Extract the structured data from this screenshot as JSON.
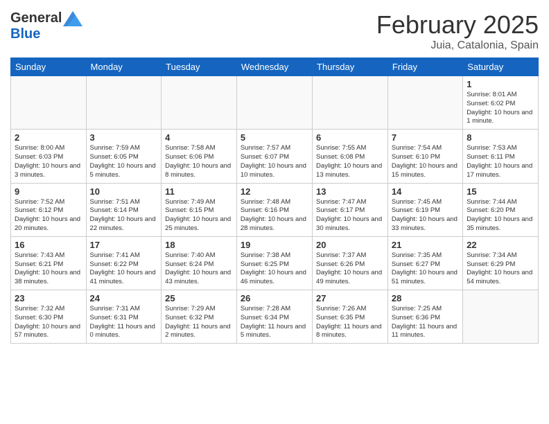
{
  "header": {
    "logo_general": "General",
    "logo_blue": "Blue",
    "title": "February 2025",
    "location": "Juia, Catalonia, Spain"
  },
  "days_of_week": [
    "Sunday",
    "Monday",
    "Tuesday",
    "Wednesday",
    "Thursday",
    "Friday",
    "Saturday"
  ],
  "weeks": [
    [
      {
        "day": "",
        "info": ""
      },
      {
        "day": "",
        "info": ""
      },
      {
        "day": "",
        "info": ""
      },
      {
        "day": "",
        "info": ""
      },
      {
        "day": "",
        "info": ""
      },
      {
        "day": "",
        "info": ""
      },
      {
        "day": "1",
        "info": "Sunrise: 8:01 AM\nSunset: 6:02 PM\nDaylight: 10 hours and 1 minute."
      }
    ],
    [
      {
        "day": "2",
        "info": "Sunrise: 8:00 AM\nSunset: 6:03 PM\nDaylight: 10 hours and 3 minutes."
      },
      {
        "day": "3",
        "info": "Sunrise: 7:59 AM\nSunset: 6:05 PM\nDaylight: 10 hours and 5 minutes."
      },
      {
        "day": "4",
        "info": "Sunrise: 7:58 AM\nSunset: 6:06 PM\nDaylight: 10 hours and 8 minutes."
      },
      {
        "day": "5",
        "info": "Sunrise: 7:57 AM\nSunset: 6:07 PM\nDaylight: 10 hours and 10 minutes."
      },
      {
        "day": "6",
        "info": "Sunrise: 7:55 AM\nSunset: 6:08 PM\nDaylight: 10 hours and 13 minutes."
      },
      {
        "day": "7",
        "info": "Sunrise: 7:54 AM\nSunset: 6:10 PM\nDaylight: 10 hours and 15 minutes."
      },
      {
        "day": "8",
        "info": "Sunrise: 7:53 AM\nSunset: 6:11 PM\nDaylight: 10 hours and 17 minutes."
      }
    ],
    [
      {
        "day": "9",
        "info": "Sunrise: 7:52 AM\nSunset: 6:12 PM\nDaylight: 10 hours and 20 minutes."
      },
      {
        "day": "10",
        "info": "Sunrise: 7:51 AM\nSunset: 6:14 PM\nDaylight: 10 hours and 22 minutes."
      },
      {
        "day": "11",
        "info": "Sunrise: 7:49 AM\nSunset: 6:15 PM\nDaylight: 10 hours and 25 minutes."
      },
      {
        "day": "12",
        "info": "Sunrise: 7:48 AM\nSunset: 6:16 PM\nDaylight: 10 hours and 28 minutes."
      },
      {
        "day": "13",
        "info": "Sunrise: 7:47 AM\nSunset: 6:17 PM\nDaylight: 10 hours and 30 minutes."
      },
      {
        "day": "14",
        "info": "Sunrise: 7:45 AM\nSunset: 6:19 PM\nDaylight: 10 hours and 33 minutes."
      },
      {
        "day": "15",
        "info": "Sunrise: 7:44 AM\nSunset: 6:20 PM\nDaylight: 10 hours and 35 minutes."
      }
    ],
    [
      {
        "day": "16",
        "info": "Sunrise: 7:43 AM\nSunset: 6:21 PM\nDaylight: 10 hours and 38 minutes."
      },
      {
        "day": "17",
        "info": "Sunrise: 7:41 AM\nSunset: 6:22 PM\nDaylight: 10 hours and 41 minutes."
      },
      {
        "day": "18",
        "info": "Sunrise: 7:40 AM\nSunset: 6:24 PM\nDaylight: 10 hours and 43 minutes."
      },
      {
        "day": "19",
        "info": "Sunrise: 7:38 AM\nSunset: 6:25 PM\nDaylight: 10 hours and 46 minutes."
      },
      {
        "day": "20",
        "info": "Sunrise: 7:37 AM\nSunset: 6:26 PM\nDaylight: 10 hours and 49 minutes."
      },
      {
        "day": "21",
        "info": "Sunrise: 7:35 AM\nSunset: 6:27 PM\nDaylight: 10 hours and 51 minutes."
      },
      {
        "day": "22",
        "info": "Sunrise: 7:34 AM\nSunset: 6:29 PM\nDaylight: 10 hours and 54 minutes."
      }
    ],
    [
      {
        "day": "23",
        "info": "Sunrise: 7:32 AM\nSunset: 6:30 PM\nDaylight: 10 hours and 57 minutes."
      },
      {
        "day": "24",
        "info": "Sunrise: 7:31 AM\nSunset: 6:31 PM\nDaylight: 11 hours and 0 minutes."
      },
      {
        "day": "25",
        "info": "Sunrise: 7:29 AM\nSunset: 6:32 PM\nDaylight: 11 hours and 2 minutes."
      },
      {
        "day": "26",
        "info": "Sunrise: 7:28 AM\nSunset: 6:34 PM\nDaylight: 11 hours and 5 minutes."
      },
      {
        "day": "27",
        "info": "Sunrise: 7:26 AM\nSunset: 6:35 PM\nDaylight: 11 hours and 8 minutes."
      },
      {
        "day": "28",
        "info": "Sunrise: 7:25 AM\nSunset: 6:36 PM\nDaylight: 11 hours and 11 minutes."
      },
      {
        "day": "",
        "info": ""
      }
    ]
  ]
}
